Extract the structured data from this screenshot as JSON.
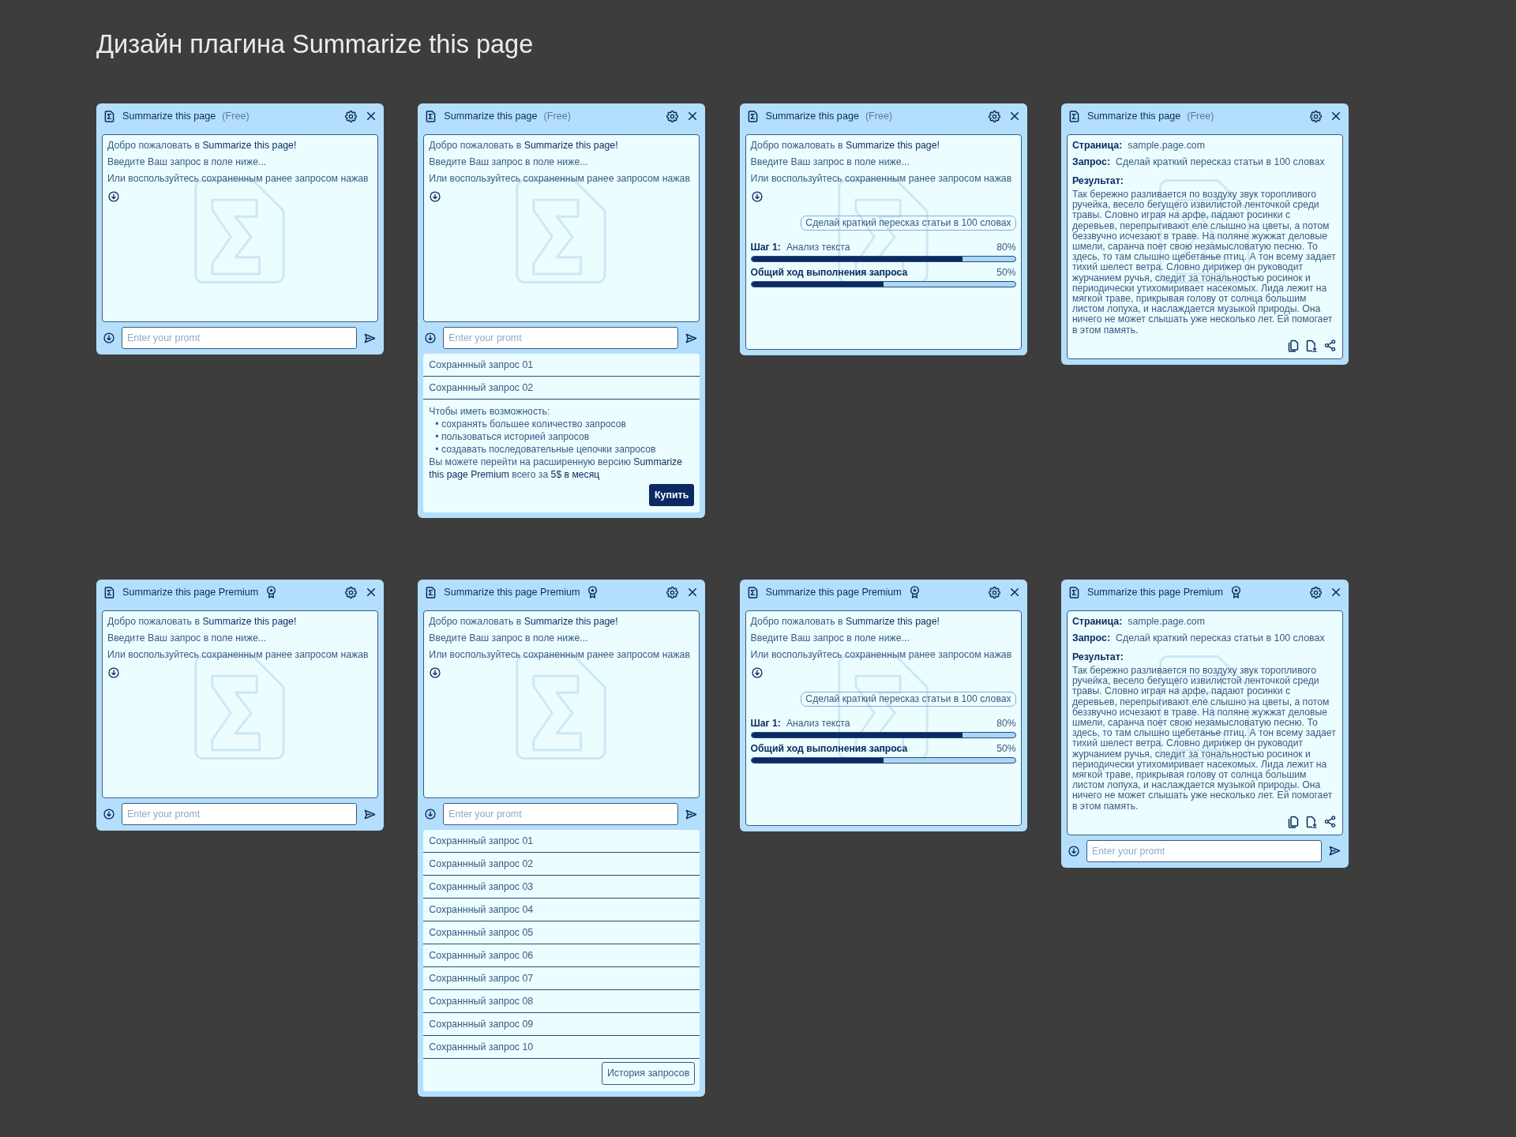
{
  "page_title": "Дизайн плагина Summarize this page",
  "panels": [
    {
      "title": "Summarize this page",
      "plan_label": "(Free)",
      "body": {
        "kind": "welcome",
        "lines": [
          "Добро пожаловать в **Summarize this page!**",
          "Введите Ваш запрос в поле ниже...",
          "Или воспользуйтесь сохраненным ранее запросом нажав"
        ]
      },
      "prompt": {
        "placeholder": "Enter your promt"
      }
    },
    {
      "title": "Summarize this page",
      "plan_label": "(Free)",
      "body": {
        "kind": "welcome",
        "lines": [
          "Добро пожаловать в **Summarize this page!**",
          "Введите Ваш запрос в поле ниже...",
          "Или воспользуйтесь сохраненным ранее запросом нажав"
        ]
      },
      "prompt": {
        "placeholder": "Enter your promt"
      },
      "saved": {
        "items": [
          "Сохраннный запрос 01",
          "Сохраннный запрос 02"
        ],
        "footer": {
          "kind": "promo",
          "intro": "Чтобы иметь возможность:",
          "bullets": [
            "• сохранять большее количество запросов",
            "• пользоваться историей запросов",
            "• создавать последовательные цепочки запросов"
          ],
          "offer": "Вы можете перейти на расширенную версию **Summarize this page Premium** всего за **5$ в месяц**",
          "button": "Купить"
        }
      }
    },
    {
      "title": "Summarize this page",
      "plan_label": "(Free)",
      "body": {
        "kind": "progress",
        "lines": [
          "Добро пожаловать в **Summarize this page!**",
          "Введите Ваш запрос в поле ниже...",
          "Или воспользуйтесь сохраненным ранее запросом нажав"
        ],
        "request": "Сделай краткий пересказ статьи в 100 словах",
        "steps": [
          {
            "label": "Шаг 1:",
            "text": "Анализ текста",
            "reading": "80%",
            "level": 0.8
          },
          {
            "label": "Общий ход выполнения запроса",
            "reading": "50%",
            "level": 0.5
          }
        ]
      }
    },
    {
      "title": "Summarize this page",
      "plan_label": "(Free)",
      "body": {
        "kind": "result",
        "fields": [
          {
            "label": "Страница:",
            "value": "sample.page.com"
          },
          {
            "label": "Запрос:",
            "value": "Сделай краткий пересказ статьи в 100 словах"
          }
        ],
        "result_label": "Результат:",
        "result_text": "Так бережно разливается по воздуху звук торопливого ручейка, весело бегущего извилистой ленточкой среди травы. Словно играя на арфе, падают росинки с деревьев, перепрыгивают еле слышно на цветы, а потом беззвучно исчезают в траве. На поляне жужжат деловые шмели, саранча поет свою незамысловатую песню. То здесь, то там слышно щебетанье птиц. А тон всему задает тихий шелест ветра. Словно дирижер он руководит журчанием ручья, следит за тональностью росинок и периодически утихомиривает насекомых. Лида лежит на мягкой траве, прикрывая голову от солнца большим листом лопуха, и наслаждается музыкой природы. Она ничего не может слышать уже несколько лет. Ей помогает в этом память."
      }
    },
    {
      "title": "Summarize this page Premium",
      "premium_badge": true,
      "body": {
        "kind": "welcome",
        "lines": [
          "Добро пожаловать в **Summarize this page!**",
          "Введите Ваш запрос в поле ниже...",
          "Или воспользуйтесь сохраненным ранее запросом нажав"
        ]
      },
      "prompt": {
        "placeholder": "Enter your promt"
      }
    },
    {
      "title": "Summarize this page Premium",
      "premium_badge": true,
      "body": {
        "kind": "welcome",
        "lines": [
          "Добро пожаловать в **Summarize this page!**",
          "Введите Ваш запрос в поле ниже...",
          "Или воспользуйтесь сохраненным ранее запросом нажав"
        ]
      },
      "prompt": {
        "placeholder": "Enter your promt"
      },
      "saved": {
        "items": [
          "Сохраннный запрос 01",
          "Сохраннный запрос 02",
          "Сохраннный запрос 03",
          "Сохраннный запрос 04",
          "Сохраннный запрос 05",
          "Сохраннный запрос 06",
          "Сохраннный запрос 07",
          "Сохраннный запрос 08",
          "Сохраннный запрос 09",
          "Сохраннный запрос 10"
        ],
        "footer": {
          "kind": "history",
          "button": "История запросов"
        }
      }
    },
    {
      "title": "Summarize this page Premium",
      "premium_badge": true,
      "body": {
        "kind": "progress",
        "lines": [
          "Добро пожаловать в **Summarize this page!**",
          "Введите Ваш запрос в поле ниже...",
          "Или воспользуйтесь сохраненным ранее запросом нажав"
        ],
        "request": "Сделай краткий пересказ статьи в 100 словах",
        "steps": [
          {
            "label": "Шаг 1:",
            "text": "Анализ текста",
            "reading": "80%",
            "level": 0.8
          },
          {
            "label": "Общий ход выполнения запроса",
            "reading": "50%",
            "level": 0.5
          }
        ]
      }
    },
    {
      "title": "Summarize this page Premium",
      "premium_badge": true,
      "body": {
        "kind": "result",
        "fields": [
          {
            "label": "Страница:",
            "value": "sample.page.com"
          },
          {
            "label": "Запрос:",
            "value": "Сделай краткий пересказ статьи в 100 словах"
          }
        ],
        "result_label": "Результат:",
        "result_text": "Так бережно разливается по воздуху звук торопливого ручейка, весело бегущего извилистой ленточкой среди травы. Словно играя на арфе, падают росинки с деревьев, перепрыгивают еле слышно на цветы, а потом беззвучно исчезают в траве. На поляне жужжат деловые шмели, саранча поет свою незамысловатую песню. То здесь, то там слышно щебетанье птиц. А тон всему задает тихий шелест ветра. Словно дирижер он руководит журчанием ручья, следит за тональностью росинок и периодически утихомиривает насекомых. Лида лежит на мягкой траве, прикрывая голову от солнца большим листом лопуха, и наслаждается музыкой природы. Она ничего не может слышать уже несколько лет. Ей помогает в этом память."
      },
      "prompt": {
        "placeholder": "Enter your promt"
      }
    }
  ]
}
